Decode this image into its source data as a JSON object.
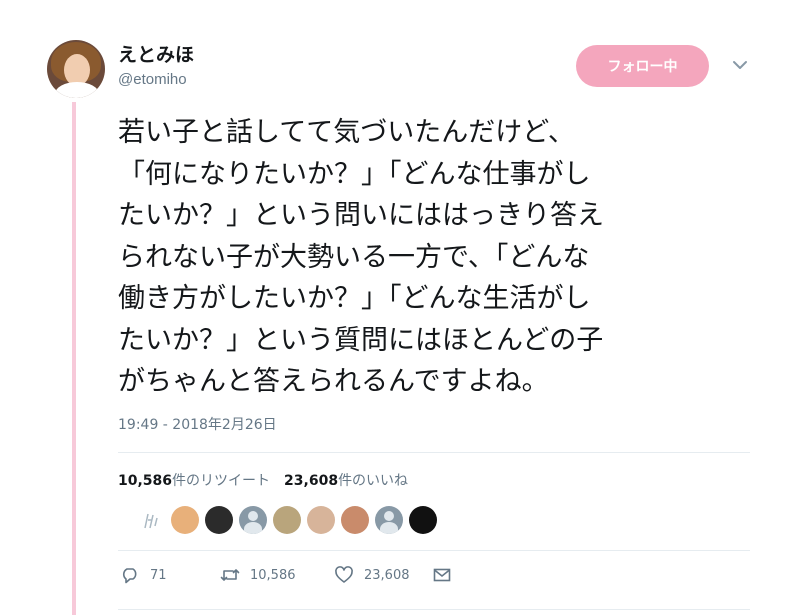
{
  "user": {
    "display_name": "えとみほ",
    "screen_name": "@etomiho"
  },
  "follow_button_label": "フォロー中",
  "tweet": {
    "text": "若い子と話してて気づいたんだけど、\n「何になりたいか？」「どんな仕事がし\nたいか？」という問いにははっきり答え\nられない子が大勢いる一方で、「どんな\n働き方がしたいか？」「どんな生活がし\nたいか？」という質問にはほとんどの子\nがちゃんと答えられるんですよね。",
    "timestamp": "19:49 - 2018年2月26日"
  },
  "stats": {
    "retweet_count": "10,586",
    "retweet_label": "件のリツイート",
    "like_count": "23,608",
    "like_label": "件のいいね"
  },
  "actions": {
    "reply_count": "71",
    "retweet_count": "10,586",
    "like_count": "23,608"
  },
  "icons": {
    "caret": "chevron-down-icon",
    "reply": "reply-icon",
    "retweet": "retweet-icon",
    "like": "heart-icon",
    "dm": "envelope-icon"
  },
  "colors": {
    "accent_pink": "#f4a6bd",
    "thread_line": "#f7c9d9",
    "secondary_text": "#657786"
  }
}
